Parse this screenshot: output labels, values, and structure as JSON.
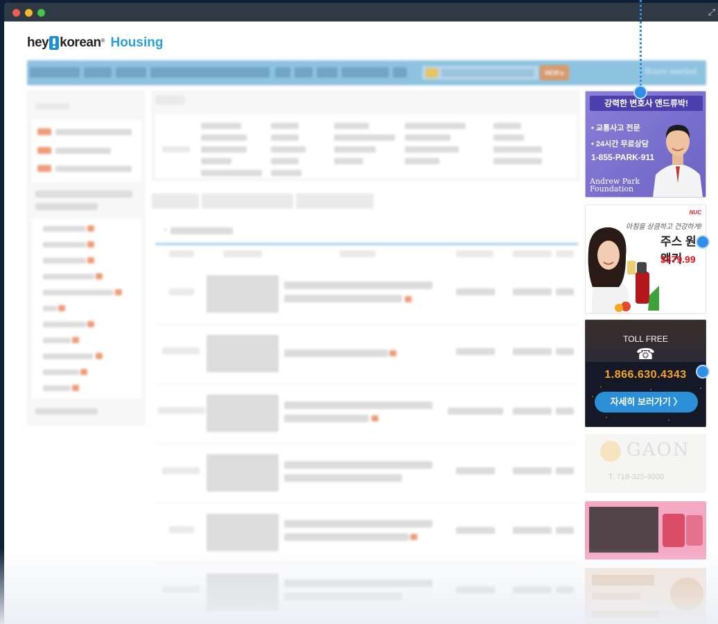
{
  "window": {
    "controls": [
      "close",
      "minimize",
      "maximize"
    ],
    "colors": {
      "close": "#f05b52",
      "minimize": "#f5b92d",
      "maximize": "#4ac54a"
    }
  },
  "logo": {
    "hey": "hey",
    "korean": "korean",
    "reg": "®",
    "housing": "Housing"
  },
  "nav": {
    "new_label": "NEW ▸",
    "room_wanted": "Room wanted"
  },
  "ads": {
    "lawyer": {
      "headline": "강력한 변호사 앤드류박!",
      "bullet1": "• 교통사고 전문",
      "bullet2": "• 24시간 무료상담",
      "phone": "1-855-PARK-911",
      "foundation_line1": "Andrew Park",
      "foundation_line2": "Foundation"
    },
    "juicer": {
      "brand": "NUC",
      "tagline": "아침을 상큼하고 건강하게!",
      "title": "주스 원액기",
      "price": "$379.99"
    },
    "tollfree": {
      "label": "TOLL FREE",
      "icon": "☎",
      "number": "1.866.630.4343",
      "button": "자세히 보러가기 〉"
    },
    "gaon": {
      "name": "GAON",
      "phone": "T. 718-325-9000"
    }
  },
  "colors": {
    "accent": "#2f8ee8",
    "nav": "#8ec3e0",
    "orange": "#f6a623"
  }
}
